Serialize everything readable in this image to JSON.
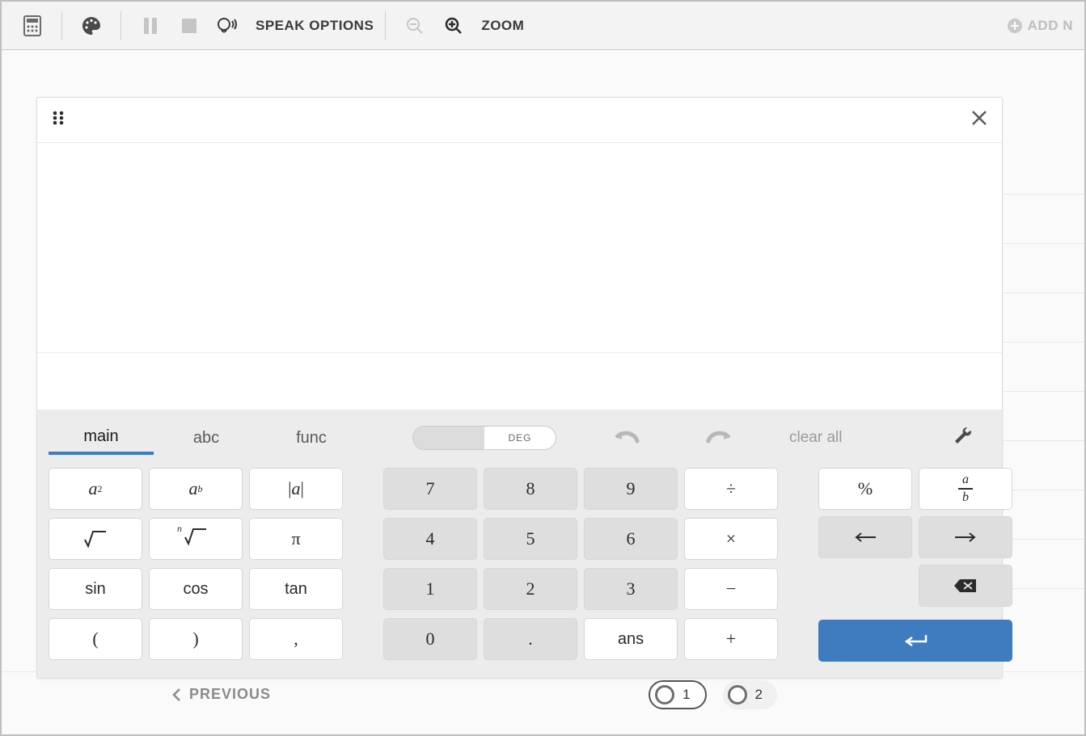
{
  "toolbar": {
    "speak_label": "SPEAK OPTIONS",
    "zoom_label": "ZOOM",
    "add_note_label": "ADD N"
  },
  "calc": {
    "tabs": {
      "main": "main",
      "abc": "abc",
      "func": "func"
    },
    "mode": {
      "rad": "",
      "deg": "DEG"
    },
    "clear_all": "clear all",
    "keys_left": {
      "a2": "a",
      "a2_sup": "2",
      "ab": "a",
      "ab_sup": "b",
      "abs": "|",
      "abs_mid": "a",
      "abs2": "|",
      "sqrt": "√",
      "nroot_n": "n",
      "nroot": "√",
      "pi": "π",
      "sin": "sin",
      "cos": "cos",
      "tan": "tan",
      "lparen": "(",
      "rparen": ")",
      "comma": ","
    },
    "keys_mid": {
      "7": "7",
      "8": "8",
      "9": "9",
      "div": "÷",
      "4": "4",
      "5": "5",
      "6": "6",
      "mul": "×",
      "1": "1",
      "2": "2",
      "3": "3",
      "sub": "−",
      "0": "0",
      "dot": ".",
      "ans": "ans",
      "add": "+"
    },
    "keys_right": {
      "pct": "%",
      "frac_a": "a",
      "frac_b": "b"
    }
  },
  "nav": {
    "previous": "PREVIOUS",
    "pages": [
      "1",
      "2"
    ]
  }
}
